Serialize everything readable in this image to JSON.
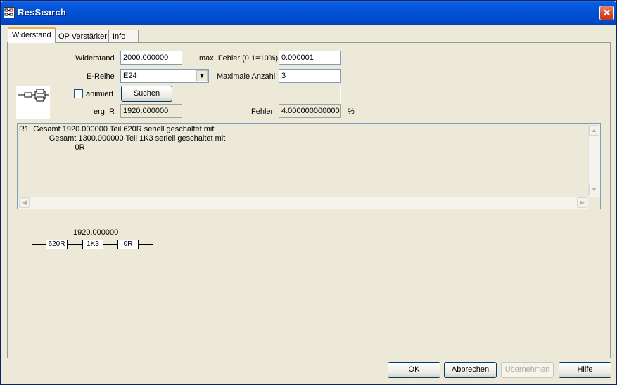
{
  "window": {
    "title": "ResSearch",
    "close_glyph": "✕"
  },
  "tabs": [
    {
      "label": "Widerstand",
      "active": true
    },
    {
      "label": "OP Verstärker",
      "active": false
    },
    {
      "label": "Info",
      "active": false
    }
  ],
  "form": {
    "widerstand_label": "Widerstand",
    "widerstand_value": "2000.000000",
    "max_fehler_label": "max. Fehler (0,1=10%)",
    "max_fehler_value": "0.000001",
    "ereihe_label": "E-Reihe",
    "ereihe_value": "E24",
    "max_anzahl_label": "Maximale Anzahl",
    "max_anzahl_value": "3",
    "animiert_label": "animiert",
    "animiert_checked": false,
    "suchen_label": "Suchen",
    "erg_r_label": "erg. R",
    "erg_r_value": "1920.000000",
    "fehler_label": "Fehler",
    "fehler_value": "4.000000000000",
    "percent_label": "%"
  },
  "result_text": {
    "line1": "R1: Gesamt 1920.000000 Teil 620R seriell geschaltet mit",
    "line2": "              Gesamt 1300.000000 Teil 1K3 seriell geschaltet mit",
    "line3": "                          0R"
  },
  "circuit": {
    "total_label": "1920.000000",
    "resistors": [
      "620R",
      "1K3",
      "0R"
    ]
  },
  "buttons": {
    "ok": "OK",
    "abbrechen": "Abbrechen",
    "uebernehmen": "Übernehmen",
    "hilfe": "Hilfe"
  },
  "colors": {
    "titlebar": "#0052d6",
    "dialog_bg": "#ece9d8",
    "close_button": "#d1492c",
    "active_tab_accent": "#f4b33c"
  }
}
